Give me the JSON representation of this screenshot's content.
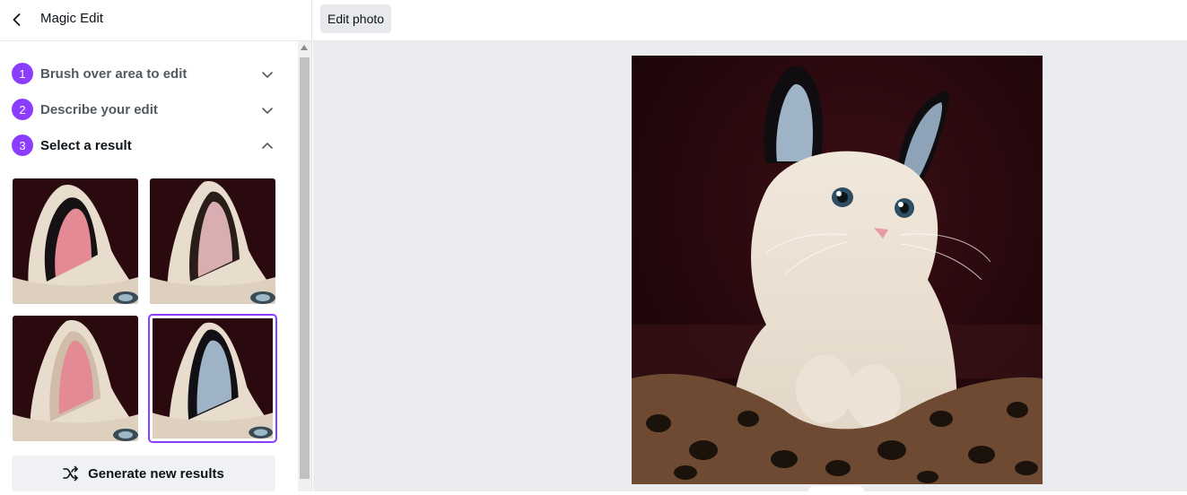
{
  "panel": {
    "title": "Magic Edit",
    "back_icon": "chevron-left-icon",
    "steps": [
      {
        "number": "1",
        "label": "Brush over area to edit",
        "state": "collapsed"
      },
      {
        "number": "2",
        "label": "Describe your edit",
        "state": "collapsed"
      },
      {
        "number": "3",
        "label": "Select a result",
        "state": "expanded"
      }
    ],
    "results": [
      {
        "variant": "pink-ear",
        "selected": false
      },
      {
        "variant": "light-ear",
        "selected": false
      },
      {
        "variant": "pink-ear-2",
        "selected": false
      },
      {
        "variant": "blue-ear",
        "selected": true
      }
    ],
    "generate_button": {
      "label": "Generate new results",
      "icon": "shuffle-icon"
    }
  },
  "topbar": {
    "edit_photo_label": "Edit photo"
  },
  "colors": {
    "accent": "#8b3dff",
    "canvas_bg": "#ebecf0",
    "photo_bg": "#2b0a0f"
  }
}
